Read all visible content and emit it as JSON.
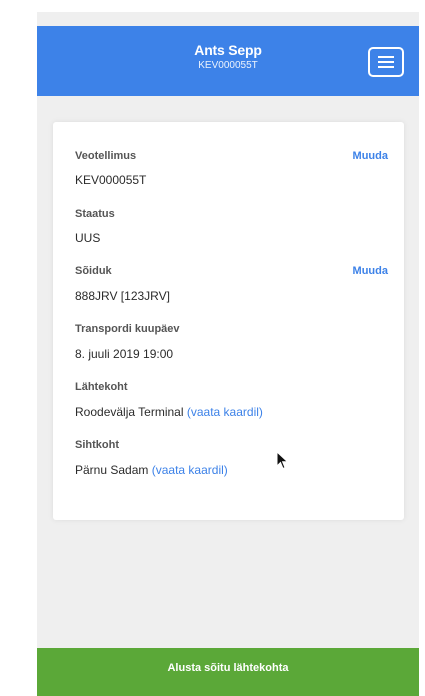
{
  "header": {
    "user_name": "Ants Sepp",
    "order_code": "KEV000055T"
  },
  "details": {
    "order_label": "Veotellimus",
    "order_value": "KEV000055T",
    "order_edit": "Muuda",
    "status_label": "Staatus",
    "status_value": "UUS",
    "vehicle_label": "Sõiduk",
    "vehicle_value": "888JRV [123JRV]",
    "vehicle_edit": "Muuda",
    "transport_date_label": "Transpordi kuupäev",
    "transport_date_value": "8. juuli 2019 19:00",
    "origin_label": "Lähtekoht",
    "origin_value": "Roodevälja Terminal",
    "origin_map_link": "(vaata kaardil)",
    "destination_label": "Sihtkoht",
    "destination_value": "Pärnu Sadam",
    "destination_map_link": "(vaata kaardil)"
  },
  "footer": {
    "start_trip_label": "Alusta sõitu lähtekohta"
  },
  "colors": {
    "header_blue": "#3d82e8",
    "footer_green": "#5ba838",
    "link_blue": "#3d82e8"
  }
}
